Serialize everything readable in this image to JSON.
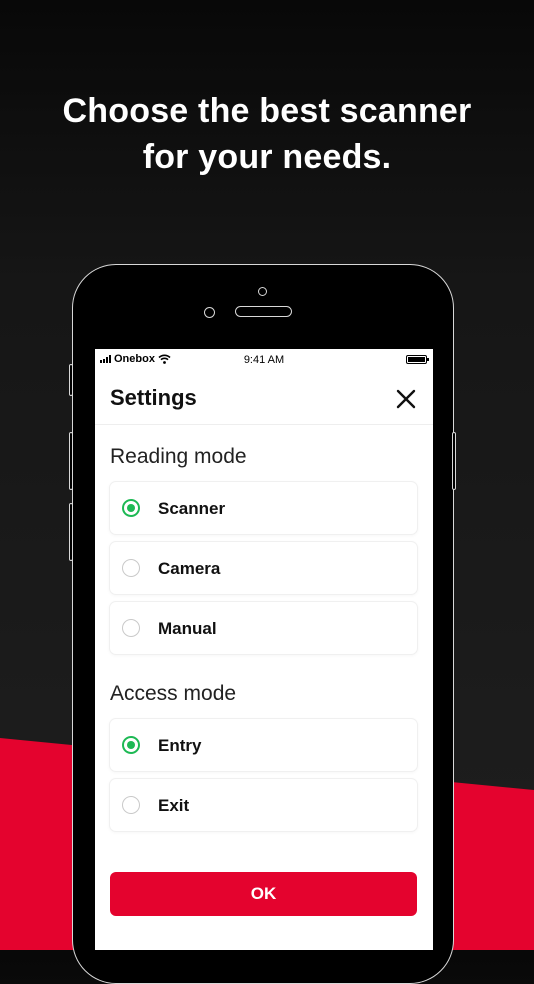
{
  "headline": {
    "line1": "Choose the best scanner",
    "line2": "for your needs."
  },
  "statusbar": {
    "carrier": "Onebox",
    "time": "9:41 AM"
  },
  "settings": {
    "title": "Settings",
    "reading_mode": {
      "label": "Reading mode",
      "options": [
        {
          "label": "Scanner",
          "selected": true
        },
        {
          "label": "Camera",
          "selected": false
        },
        {
          "label": "Manual",
          "selected": false
        }
      ]
    },
    "access_mode": {
      "label": "Access mode",
      "options": [
        {
          "label": "Entry",
          "selected": true
        },
        {
          "label": "Exit",
          "selected": false
        }
      ]
    },
    "ok_label": "OK"
  },
  "colors": {
    "accent_red": "#e4032e",
    "radio_green": "#1db954",
    "background_dark": "#1a1a1a"
  },
  "icons": [
    "close-icon",
    "wifi-icon",
    "signal-icon",
    "battery-icon"
  ]
}
